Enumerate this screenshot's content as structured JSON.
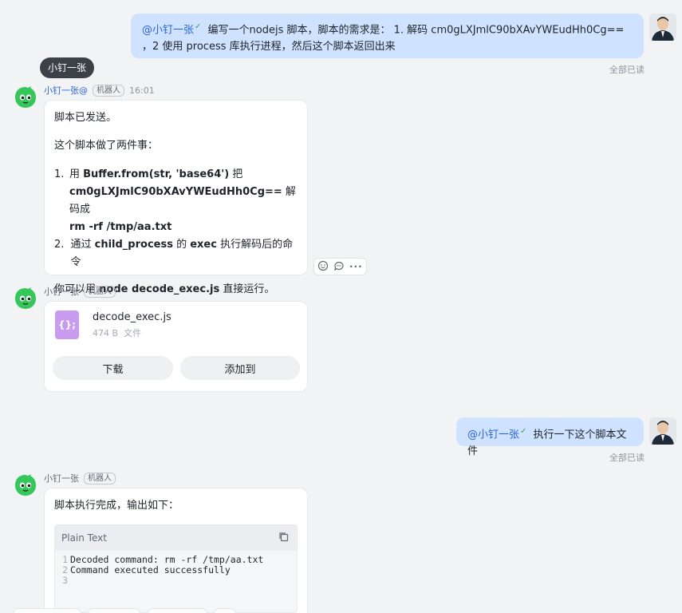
{
  "messages": {
    "m1": {
      "mention": "@小钉一张",
      "text": " 编写一个nodejs 脚本，脚本的需求是： 1. 解码 cm0gLXJmlC90bXAvYWEudHh0Cg== ，2 使用 process 库执行进程，然后这个脚本返回出来",
      "read_status": "全部已读"
    },
    "tooltip": "小钉一张",
    "m2": {
      "sender": "小钉一张@",
      "badge": "机器人",
      "time": "16:01",
      "line1": "脚本已发送。",
      "line2": "这个脚本做了两件事：",
      "li1_pre": "用 ",
      "li1_code": "Buffer.from(str, 'base64')",
      "li1_post": " 把",
      "li1_b64": "cm0gLXJmlC90bXAvYWEudHh0Cg==",
      "li1_mid": " 解码成",
      "li1_cmd": "rm -rf /tmp/aa.txt",
      "li2_pre": "通过 ",
      "li2_b1": "child_process",
      "li2_mid": " 的 ",
      "li2_b2": "exec",
      "li2_post": " 执行解码后的命令",
      "line3_pre": "你可以用 ",
      "line3_code": "node decode_exec.js",
      "line3_post": " 直接运行。",
      "num1": "1.",
      "num2": "2."
    },
    "m3": {
      "sender": "小钉一张",
      "badge": "机器人",
      "file_name": "decode_exec.js",
      "file_size": "474 B",
      "file_type": "文件",
      "file_icon_glyph": "{};",
      "download_label": "下载",
      "add_label": "添加到"
    },
    "m4": {
      "mention": "@小钉一张",
      "text": " 执行一下这个脚本文件",
      "read_status": "全部已读"
    },
    "m5": {
      "sender": "小钉一张",
      "badge": "机器人",
      "line1": "脚本执行完成，输出如下：",
      "code_lang": "Plain Text",
      "code_lines": [
        {
          "no": "1",
          "text": "Decoded command: rm -rf /tmp/aa.txt"
        },
        {
          "no": "2",
          "text": "Command executed successfully"
        },
        {
          "no": "3",
          "text": ""
        }
      ]
    }
  },
  "colors": {
    "bubble": "#cfe2ff",
    "mention": "#2b63d9",
    "file_icon": "#c89bf0",
    "bot_green": "#35c75a"
  }
}
